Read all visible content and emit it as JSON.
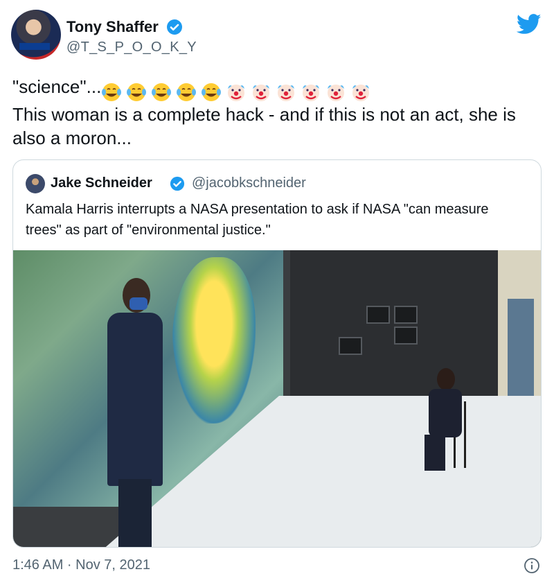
{
  "author": {
    "display_name": "Tony Shaffer",
    "handle": "@T_S_P_O_O_K_Y",
    "verified": true
  },
  "tweet": {
    "text_prefix": "\"science\"...",
    "emojis": [
      "face-with-tears-of-joy",
      "face-with-tears-of-joy",
      "face-with-tears-of-joy",
      "face-with-tears-of-joy",
      "face-with-tears-of-joy",
      "clown-face",
      "clown-face",
      "clown-face",
      "clown-face",
      "clown-face",
      "clown-face"
    ],
    "text_body": "This woman is a complete hack - and if this is not an act, she is also a moron..."
  },
  "quoted_tweet": {
    "display_name": "Jake Schneider",
    "handle": "@jacobkschneider",
    "verified": true,
    "text": "Kamala Harris interrupts a NASA presentation to ask if NASA \"can measure trees\" as part of \"environmental justice.\""
  },
  "timestamp": "1:46 AM · Nov 7, 2021",
  "icons": {
    "brand": "twitter-bird-icon",
    "verified": "verified-badge-icon",
    "info": "info-icon"
  },
  "colors": {
    "twitter_blue": "#1d9bf0",
    "muted_text": "#536471",
    "border": "#cfd9de"
  }
}
